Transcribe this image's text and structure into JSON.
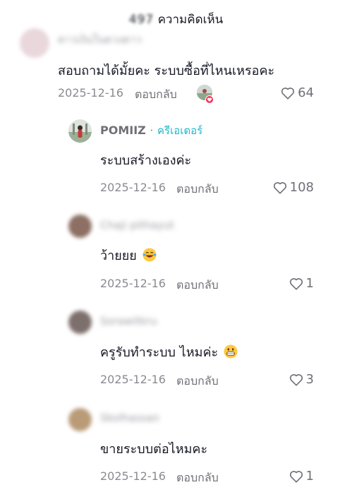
{
  "header": {
    "count": "497",
    "label": "ความคิดเห็น"
  },
  "colors": {
    "creator_badge": "#20b8c8",
    "like_heart_badge": "#fe2c55",
    "muted_text": "#8a8b91"
  },
  "comments": [
    {
      "username": "ดาวเงินในดวงดาว",
      "text": "สอบถามได้มั้ยคะ ระบบซื้อที่ไหนเหรอคะ",
      "date": "2025-12-16",
      "reply_label": "ตอบกลับ",
      "likes": "64",
      "liked_by_creator": true
    }
  ],
  "replies": [
    {
      "username": "POMIIZ",
      "creator_badge": "ครีเอเตอร์",
      "text": "ระบบสร้างเองค่ะ",
      "date": "2025-12-16",
      "reply_label": "ตอบกลับ",
      "likes": "108"
    },
    {
      "username": "Chaji pithayut",
      "text": "ว้ายยย",
      "emoji": "laughing-face-emoji",
      "date": "2025-12-16",
      "reply_label": "ตอบกลับ",
      "likes": "1"
    },
    {
      "username": "Sorawitkru",
      "text": "ครูรับทำระบบ ไหมค่ะ",
      "emoji": "grinning-face-emoji",
      "date": "2025-12-16",
      "reply_label": "ตอบกลับ",
      "likes": "3"
    },
    {
      "username": "Skolhassan",
      "text": "ขายระบบต่อไหมคะ",
      "date": "2025-12-16",
      "reply_label": "ตอบกลับ",
      "likes": "1"
    }
  ]
}
